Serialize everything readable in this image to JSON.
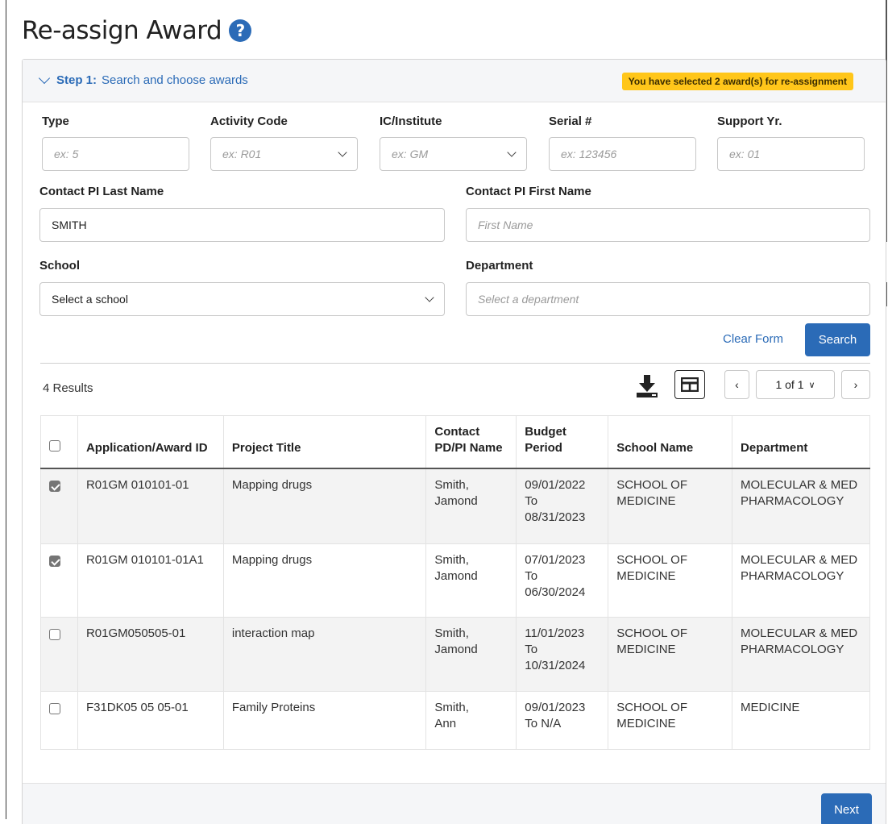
{
  "page": {
    "title": "Re-assign Award"
  },
  "step": {
    "label_bold": "Step 1:",
    "label_rest": " Search and choose awards",
    "badge": "You have selected 2 award(s) for re-assignment"
  },
  "form": {
    "type": {
      "label": "Type",
      "placeholder": "ex: 5"
    },
    "activity_code": {
      "label": "Activity Code",
      "placeholder": "ex: R01"
    },
    "ic_institute": {
      "label": "IC/Institute",
      "placeholder": "ex: GM"
    },
    "serial": {
      "label": "Serial #",
      "placeholder": "ex: 123456"
    },
    "support_yr": {
      "label": "Support Yr.",
      "placeholder": "ex: 01"
    },
    "pi_last": {
      "label": "Contact PI Last Name",
      "value": "SMITH"
    },
    "pi_first": {
      "label": "Contact PI First Name",
      "placeholder": "First Name"
    },
    "school": {
      "label": "School",
      "value": "Select a school"
    },
    "department": {
      "label": "Department",
      "placeholder": "Select a department"
    },
    "clear_label": "Clear Form",
    "search_label": "Search"
  },
  "results": {
    "count_text": "4 Results",
    "pager": "1 of 1",
    "columns": [
      "Application/Award ID",
      "Project Title",
      "Contact PD/PI Name",
      "Budget Period",
      "School Name",
      "Department"
    ],
    "rows": [
      {
        "checked": true,
        "id": "R01GM 010101-01",
        "title": "Mapping drugs",
        "pi_last": "Smith,",
        "pi_first": "Jamond",
        "bp_start": "09/01/2022",
        "bp_to": "To",
        "bp_end": "08/31/2023",
        "school": "SCHOOL OF MEDICINE",
        "dept": "MOLECULAR & MED PHARMACOLOGY"
      },
      {
        "checked": true,
        "id": "R01GM 010101-01A1",
        "title": "Mapping drugs",
        "pi_last": "Smith,",
        "pi_first": "Jamond",
        "bp_start": "07/01/2023",
        "bp_to": "To",
        "bp_end": "06/30/2024",
        "school": "SCHOOL OF MEDICINE",
        "dept": "MOLECULAR & MED PHARMACOLOGY"
      },
      {
        "checked": false,
        "id": "R01GM050505-01",
        "title": "interaction map",
        "pi_last": "Smith,",
        "pi_first": "Jamond",
        "bp_start": "11/01/2023",
        "bp_to": "To",
        "bp_end": "10/31/2024",
        "school": "SCHOOL OF MEDICINE",
        "dept": "MOLECULAR & MED PHARMACOLOGY"
      },
      {
        "checked": false,
        "id": "F31DK05 05 05-01",
        "title": "Family Proteins",
        "pi_last": "Smith,",
        "pi_first": "Ann",
        "bp_start": "09/01/2023",
        "bp_to": "To N/A",
        "bp_end": "",
        "school": "SCHOOL OF MEDICINE",
        "dept": "MEDICINE"
      }
    ]
  },
  "footer": {
    "next_label": "Next"
  },
  "colors": {
    "accent": "#2b6bb7",
    "badge": "#ffc61a"
  }
}
